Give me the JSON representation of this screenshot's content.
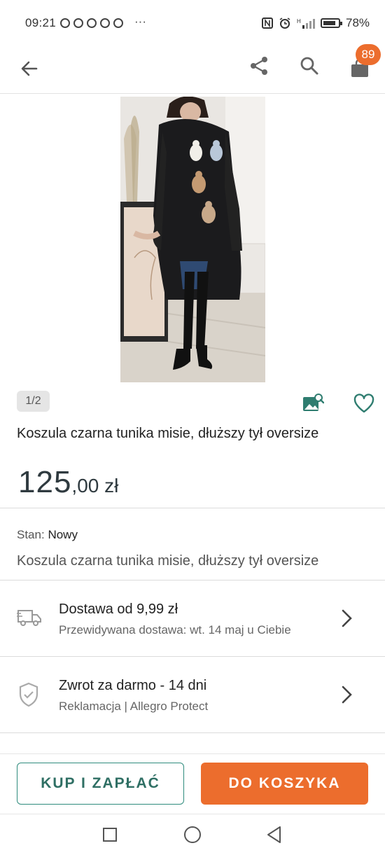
{
  "status_bar": {
    "time": "09:21",
    "more": "···",
    "battery": "78%"
  },
  "header": {
    "cart_count": "89"
  },
  "gallery": {
    "counter": "1/2"
  },
  "product": {
    "title": "Koszula czarna tunika misie, dłuższy tył oversize",
    "price_main": "125",
    "price_decimal": ",00 zł",
    "condition_label": "Stan:",
    "condition_value": "Nowy",
    "description": "Koszula czarna tunika misie, dłuższy tył oversize"
  },
  "delivery": {
    "title": "Dostawa od 9,99 zł",
    "subtitle": "Przewidywana dostawa: wt. 14 maj u Ciebie"
  },
  "returns": {
    "title": "Zwrot za darmo - 14 dni",
    "subtitle": "Reklamacja | Allegro Protect"
  },
  "actions": {
    "buy_now": "KUP I ZAPŁAĆ",
    "add_to_cart": "DO KOSZYKA"
  },
  "colors": {
    "accent_orange": "#ec6d2d",
    "accent_teal": "#2f8c7d"
  }
}
